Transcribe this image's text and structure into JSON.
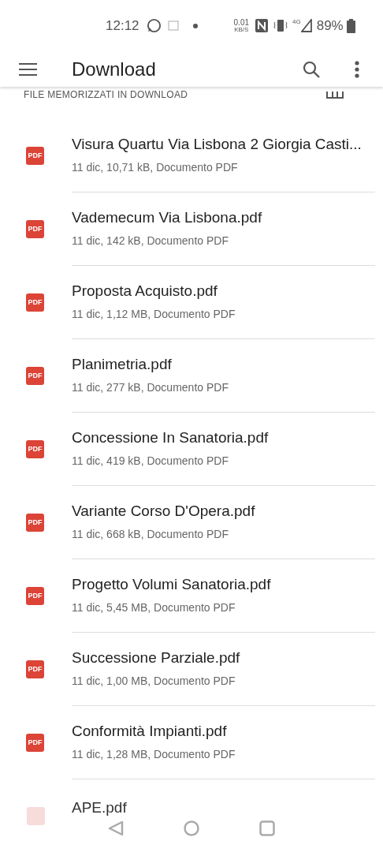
{
  "status_bar": {
    "time": "12:12",
    "speed": "0.01",
    "speed_unit": "KB/S",
    "network": "4G",
    "battery": "89%"
  },
  "app_bar": {
    "title": "Download"
  },
  "section": {
    "title": "FILE MEMORIZZATI IN DOWNLOAD"
  },
  "files": [
    {
      "icon_label": "PDF",
      "name": "Visura Quartu Via Lisbona 2 Giorgia Casti...",
      "details": "11 dic, 10,71 kB, Documento PDF"
    },
    {
      "icon_label": "PDF",
      "name": "Vademecum Via Lisbona.pdf",
      "details": "11 dic, 142 kB, Documento PDF"
    },
    {
      "icon_label": "PDF",
      "name": "Proposta Acquisto.pdf",
      "details": "11 dic, 1,12 MB, Documento PDF"
    },
    {
      "icon_label": "PDF",
      "name": "Planimetria.pdf",
      "details": "11 dic, 277 kB, Documento PDF"
    },
    {
      "icon_label": "PDF",
      "name": "Concessione In Sanatoria.pdf",
      "details": "11 dic, 419 kB, Documento PDF"
    },
    {
      "icon_label": "PDF",
      "name": "Variante Corso D'Opera.pdf",
      "details": "11 dic, 668 kB, Documento PDF"
    },
    {
      "icon_label": "PDF",
      "name": "Progetto Volumi Sanatoria.pdf",
      "details": "11 dic, 5,45 MB, Documento PDF"
    },
    {
      "icon_label": "PDF",
      "name": "Successione Parziale.pdf",
      "details": "11 dic, 1,00 MB, Documento PDF"
    },
    {
      "icon_label": "PDF",
      "name": "Conformità Impianti.pdf",
      "details": "11 dic, 1,28 MB, Documento PDF"
    }
  ],
  "last_file": {
    "name": "APE.pdf"
  }
}
